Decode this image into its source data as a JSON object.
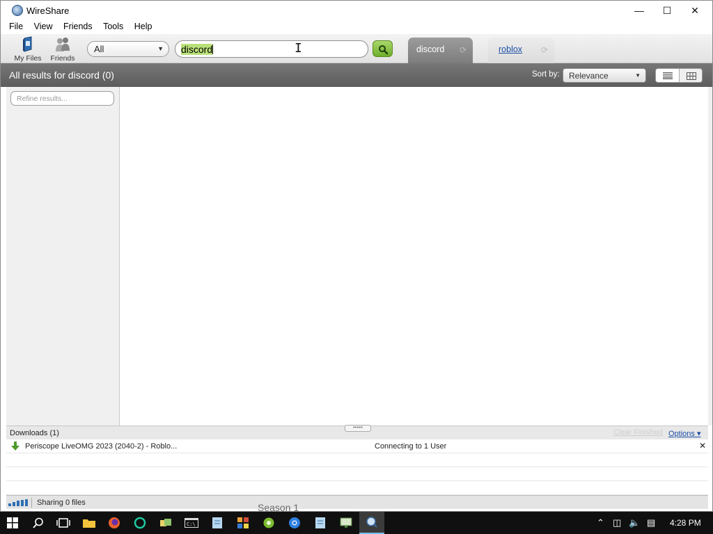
{
  "window": {
    "title": "WireShare"
  },
  "menu": [
    "File",
    "View",
    "Friends",
    "Tools",
    "Help"
  ],
  "toolbar": {
    "my_files_label": "My Files",
    "friends_label": "Friends",
    "category_value": "All",
    "search_value": "discord"
  },
  "tabs": [
    {
      "label": "discord",
      "active": true
    },
    {
      "label": "roblox",
      "active": false
    }
  ],
  "results": {
    "heading": "All results for discord (0)",
    "sort_label": "Sort by:",
    "sort_value": "Relevance"
  },
  "filter": {
    "placeholder": "Refine results..."
  },
  "downloads": {
    "header": "Downloads (1)",
    "clear_label": "Clear Finished",
    "options_label": "Options",
    "items": [
      {
        "name": "Periscope LiveOMG 2023 (2040-2) - Roblo...",
        "status": "Connecting to 1 User"
      }
    ]
  },
  "statusbar": {
    "sharing": "Sharing 0 files"
  },
  "background_text": "Season 1",
  "taskbar": {
    "time": "4:28 PM"
  },
  "colors": {
    "accent": "#76b9ed",
    "search_go": "#7dba37",
    "link": "#1c4fa6"
  }
}
